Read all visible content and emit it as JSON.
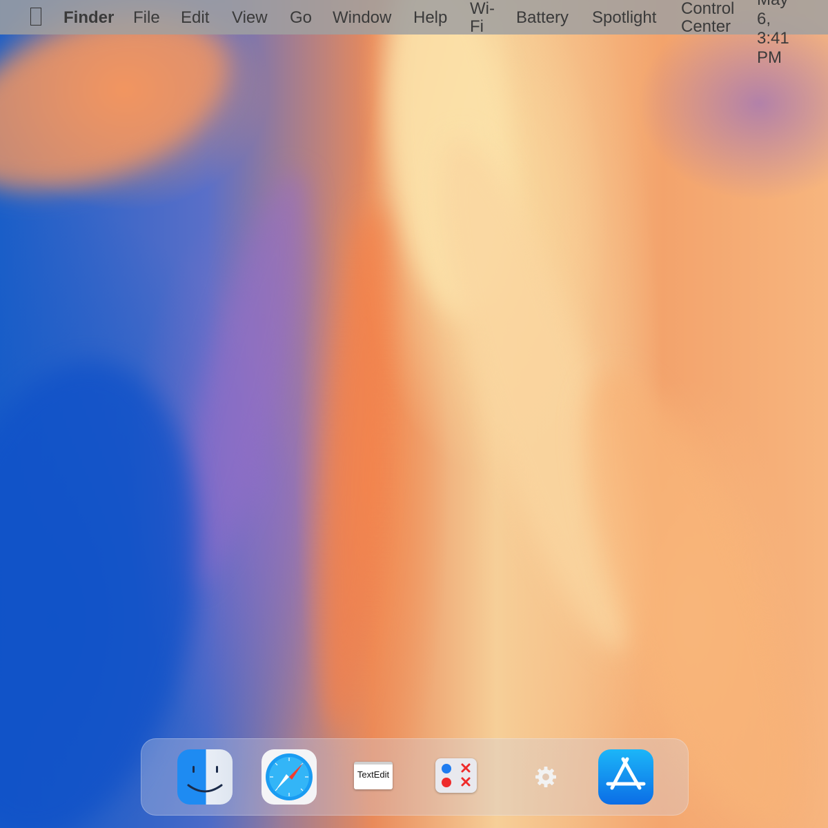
{
  "menubar": {
    "apple_icon": "apple-logo-icon",
    "app_name": "Finder",
    "menus": [
      "File",
      "Edit",
      "View",
      "Go",
      "Window",
      "Help"
    ],
    "status": {
      "wifi_line1": "Wi-",
      "wifi_line2": "Fi",
      "battery": "Battery",
      "spotlight": "Spotlight",
      "control_center_line1": "Control",
      "control_center_line2": "Center",
      "clock_line1": "May",
      "clock_line2": "6,",
      "clock_line3": "3:41",
      "clock_line4": "PM"
    }
  },
  "dock": {
    "apps": [
      {
        "icon": "finder-icon"
      },
      {
        "icon": "safari-icon"
      },
      {
        "icon": "textedit-icon",
        "label": "TextEdit"
      },
      {
        "icon": "tic-tac-toe-icon"
      },
      {
        "icon": "settings-gear-icon"
      },
      {
        "icon": "app-store-icon"
      }
    ]
  },
  "colors": {
    "menubar_bg": "#a0a0a0",
    "menubar_text": "#3a3a3a",
    "finder_blue": "#1e8bf2",
    "appstore_blue": "#0b6de6",
    "ttt_blue": "#1e7cf0",
    "ttt_red": "#ee2b2b"
  }
}
